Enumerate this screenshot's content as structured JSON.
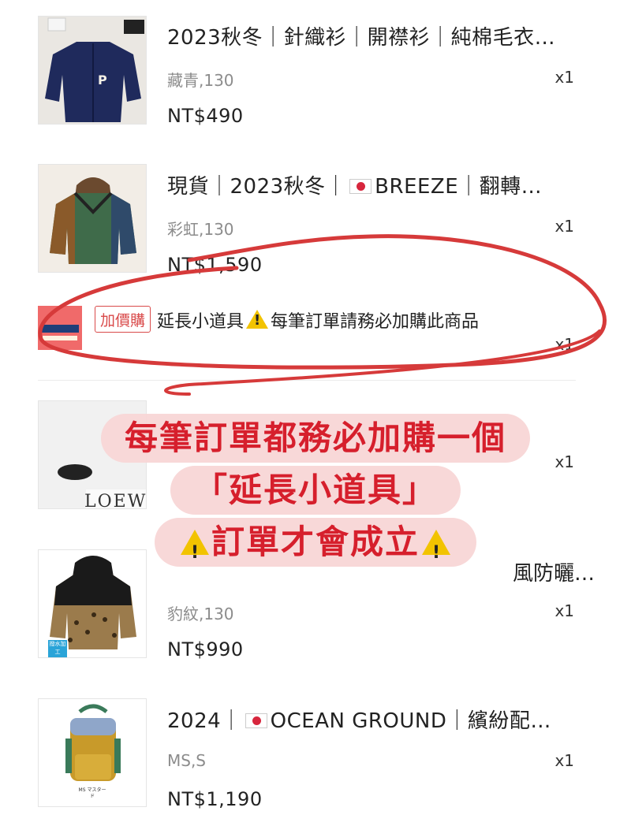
{
  "items": [
    {
      "title": "2023秋冬｜針織衫｜開襟衫｜純棉毛衣…",
      "variant": "藏青,130",
      "qty": "x1",
      "price": "NT$490"
    },
    {
      "title_parts": [
        "現貨｜2023秋冬｜",
        "BREEZE｜翻轉…"
      ],
      "variant": "彩虹,130",
      "qty": "x1",
      "price": "NT$1,590"
    },
    {
      "title_tail": "風防曬…",
      "variant": "豹紋,130",
      "qty": "x1",
      "price": "NT$990",
      "badge": "撥水加工"
    },
    {
      "title_parts": [
        "2024｜",
        "OCEAN GROUND｜繽紛配…"
      ],
      "variant": "MS,S",
      "qty": "x1",
      "price": "NT$1,190",
      "thumb_caption": "MS マスタード"
    }
  ],
  "addon": {
    "tag": "加價購",
    "title_parts": [
      "延長小道具",
      "每筆訂單請務必加購此商品"
    ],
    "qty": "x1"
  },
  "overlay": {
    "line1": "每筆訂單都務必加購一個",
    "line2": "「延長小道具」",
    "line3": "訂單才會成立"
  },
  "colors": {
    "accent_red": "#d61f2c",
    "overlay_bg": "#f8d6d6",
    "warning": "#f2c300"
  },
  "icons": [
    "warning-icon",
    "japan-flag-icon"
  ]
}
